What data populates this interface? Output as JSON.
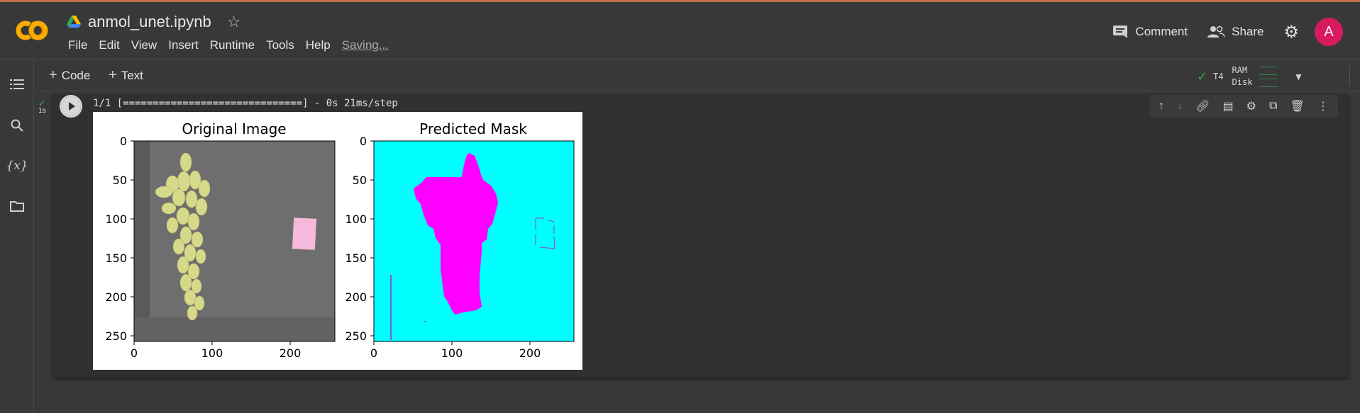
{
  "header": {
    "notebook_title": "anmol_unet.ipynb",
    "menu": [
      "File",
      "Edit",
      "View",
      "Insert",
      "Runtime",
      "Tools",
      "Help"
    ],
    "saving_status": "Saving...",
    "comment_label": "Comment",
    "share_label": "Share",
    "avatar_letter": "A",
    "avatar_color": "#d81b60"
  },
  "sidebar": {
    "icons": [
      "table-of-contents-icon",
      "search-icon",
      "variables-icon",
      "files-icon"
    ],
    "variables_glyph": "{x}"
  },
  "toolbar": {
    "code_label": "Code",
    "text_label": "Text",
    "runtime_label": "T4",
    "ram_label": "RAM",
    "disk_label": "Disk"
  },
  "cell": {
    "exec_time": "1s",
    "output_text": "1/1 [==============================] - 0s 21ms/step"
  },
  "figure": {
    "panels": [
      {
        "title": "Original Image",
        "x_ticks": [
          "0",
          "100",
          "200"
        ],
        "y_ticks": [
          "0",
          "50",
          "100",
          "150",
          "200",
          "250"
        ]
      },
      {
        "title": "Predicted Mask",
        "x_ticks": [
          "0",
          "100",
          "200"
        ],
        "y_ticks": [
          "0",
          "50",
          "100",
          "150",
          "200",
          "250"
        ]
      }
    ],
    "colors": {
      "mask_background": "#00ffff",
      "mask_foreground": "#ff00ff",
      "grape": "#d6d98a",
      "photo_bg": "#6e6e6e",
      "pink_card": "#f7b9da"
    }
  }
}
